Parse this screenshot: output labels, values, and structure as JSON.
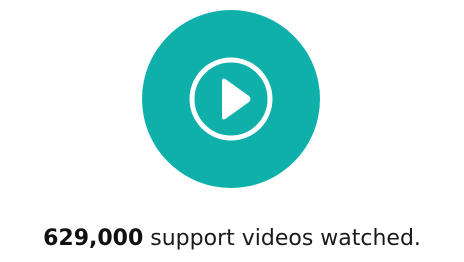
{
  "stat": {
    "number": "629,000",
    "text": " support videos watched."
  },
  "icon": {
    "name": "play-circle-icon",
    "circle_color": "#10b0aa",
    "glyph_color": "#ffffff"
  }
}
